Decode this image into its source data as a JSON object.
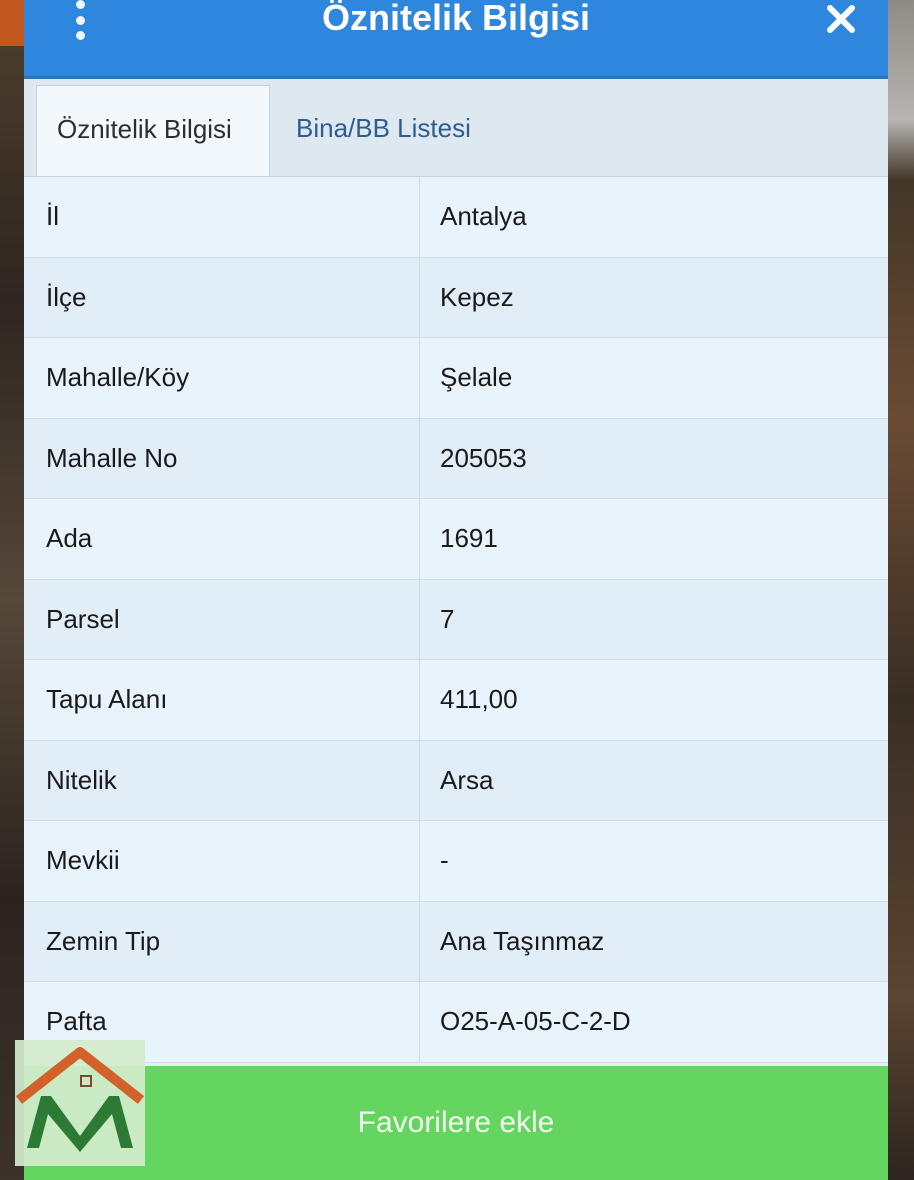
{
  "header": {
    "title": "Öznitelik Bilgisi"
  },
  "tabs": [
    {
      "label": "Öznitelik Bilgisi",
      "active": true
    },
    {
      "label": "Bina/BB Listesi",
      "active": false
    }
  ],
  "attributes": [
    {
      "key": "İl",
      "value": "Antalya"
    },
    {
      "key": "İlçe",
      "value": "Kepez"
    },
    {
      "key": "Mahalle/Köy",
      "value": "Şelale"
    },
    {
      "key": "Mahalle No",
      "value": "205053"
    },
    {
      "key": "Ada",
      "value": "1691"
    },
    {
      "key": "Parsel",
      "value": "7"
    },
    {
      "key": "Tapu Alanı",
      "value": "411,00"
    },
    {
      "key": "Nitelik",
      "value": "Arsa"
    },
    {
      "key": "Mevkii",
      "value": "-"
    },
    {
      "key": "Zemin Tip",
      "value": "Ana Taşınmaz"
    },
    {
      "key": "Pafta",
      "value": "O25-A-05-C-2-D"
    }
  ],
  "actions": {
    "favorite_label": "Favorilere ekle"
  },
  "icons": {
    "menu": "kebab-menu-icon",
    "close": "close-icon",
    "logo": "house-logo-icon"
  },
  "colors": {
    "header": "#2e86dd",
    "button": "#64d55e",
    "logo_roof": "#d2622a",
    "logo_letter": "#2d7a34"
  }
}
